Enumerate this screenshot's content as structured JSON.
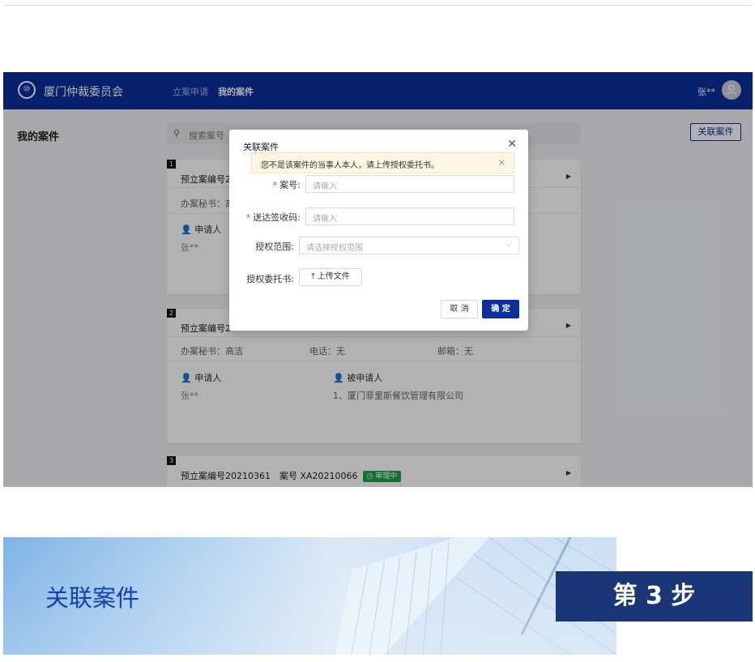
{
  "app": {
    "logo_glyph": "⑩",
    "brand": "厦门仲裁委员会",
    "nav": [
      {
        "label": "立案申请",
        "active": false
      },
      {
        "label": "我的案件",
        "active": true
      }
    ],
    "user_name": "张**",
    "page_title": "我的案件",
    "search_placeholder": "搜索案号",
    "link_case_button": "关联案件",
    "cards": [
      {
        "number": "1",
        "heading": "预立案编号20",
        "secretary": "办案秘书：高",
        "applicant_role": "申请人",
        "applicant": "张**"
      },
      {
        "number": "2",
        "heading": "预立案编号2",
        "secretary": "办案秘书：高洁",
        "phone": "电话：无",
        "email": "邮箱：无",
        "applicant_role": "申请人",
        "applicant": "张**",
        "respondent_role": "被申请人",
        "respondent": "1、厦门菲里斯餐饮管理有限公司"
      },
      {
        "number": "3",
        "heading": "预立案编号20210361　案号 XA20210066",
        "status": "审理中"
      }
    ]
  },
  "modal": {
    "title": "关联案件",
    "alert_text": "您不是该案件的当事人本人，请上传授权委托书。",
    "fields": {
      "case_no": {
        "label": "案号:",
        "placeholder": "请输入"
      },
      "code": {
        "label": "送达签收码:",
        "placeholder": "请输入"
      },
      "scope": {
        "label": "授权范围:",
        "placeholder": "请选择授权范围"
      },
      "letter": {
        "label": "授权委托书:",
        "button": "上传文件"
      }
    },
    "cancel": "取 消",
    "ok": "确 定"
  },
  "banner": {
    "title": "关联案件",
    "step": "第 3 步"
  },
  "colors": {
    "brand_blue": "#0b2f9c",
    "step_navy": "#1b3677",
    "status_green": "#1aa34a",
    "required_red": "#e34040"
  }
}
